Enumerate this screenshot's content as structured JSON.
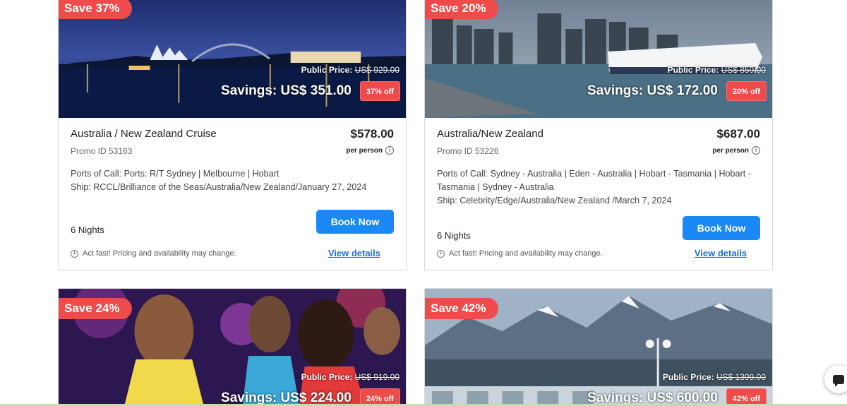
{
  "cards": [
    {
      "save_label": "Save 37%",
      "public_price_label": "Public Price:",
      "public_price_value": "US$ 929.00",
      "savings_label": "Savings: US$ 351.00",
      "off_label": "37% off",
      "title": "Australia / New Zealand Cruise",
      "price": "$578.00",
      "promo": "Promo ID 53163",
      "per_person": "per person",
      "ports_line": "Ports of Call: Ports: R/T Sydney | Melbourne | Hobart",
      "ship_line": "Ship: RCCL/Brilliance of the Seas/Australia/New Zealand/January 27, 2024",
      "nights": "6 Nights",
      "book_label": "Book Now",
      "act_fast": "Act fast! Pricing and availability may change.",
      "view_details": "View details"
    },
    {
      "save_label": "Save 20%",
      "public_price_label": "Public Price:",
      "public_price_value": "US$ 859.00",
      "savings_label": "Savings: US$ 172.00",
      "off_label": "20% off",
      "title": "Australia/New Zealand",
      "price": "$687.00",
      "promo": "Promo ID 53226",
      "per_person": "per person",
      "ports_line": "Ports of Call: Sydney - Australia | Eden - Australia | Hobart - Tasmania | Hobart - Tasmania | Sydney - Australia",
      "ship_line": "Ship: Celebrity/Edge/Australia/New Zealand /March 7, 2024",
      "nights": "6 Nights",
      "book_label": "Book Now",
      "act_fast": "Act fast! Pricing and availability may change.",
      "view_details": "View details"
    },
    {
      "save_label": "Save 24%",
      "public_price_label": "Public Price:",
      "public_price_value": "US$ 919.00",
      "savings_label": "Savings: US$ 224.00",
      "off_label": "24% off"
    },
    {
      "save_label": "Save 42%",
      "public_price_label": "Public Price:",
      "public_price_value": "US$ 1399.00",
      "savings_label": "Savings: US$ 600.00",
      "off_label": "42% off"
    }
  ],
  "icons": {
    "info": "info-icon",
    "clock": "clock-icon",
    "chat": "chat-icon"
  },
  "colors": {
    "accent_red": "#ef4b4b",
    "button_blue": "#1a88f5",
    "link_blue": "#1a6fd9"
  }
}
